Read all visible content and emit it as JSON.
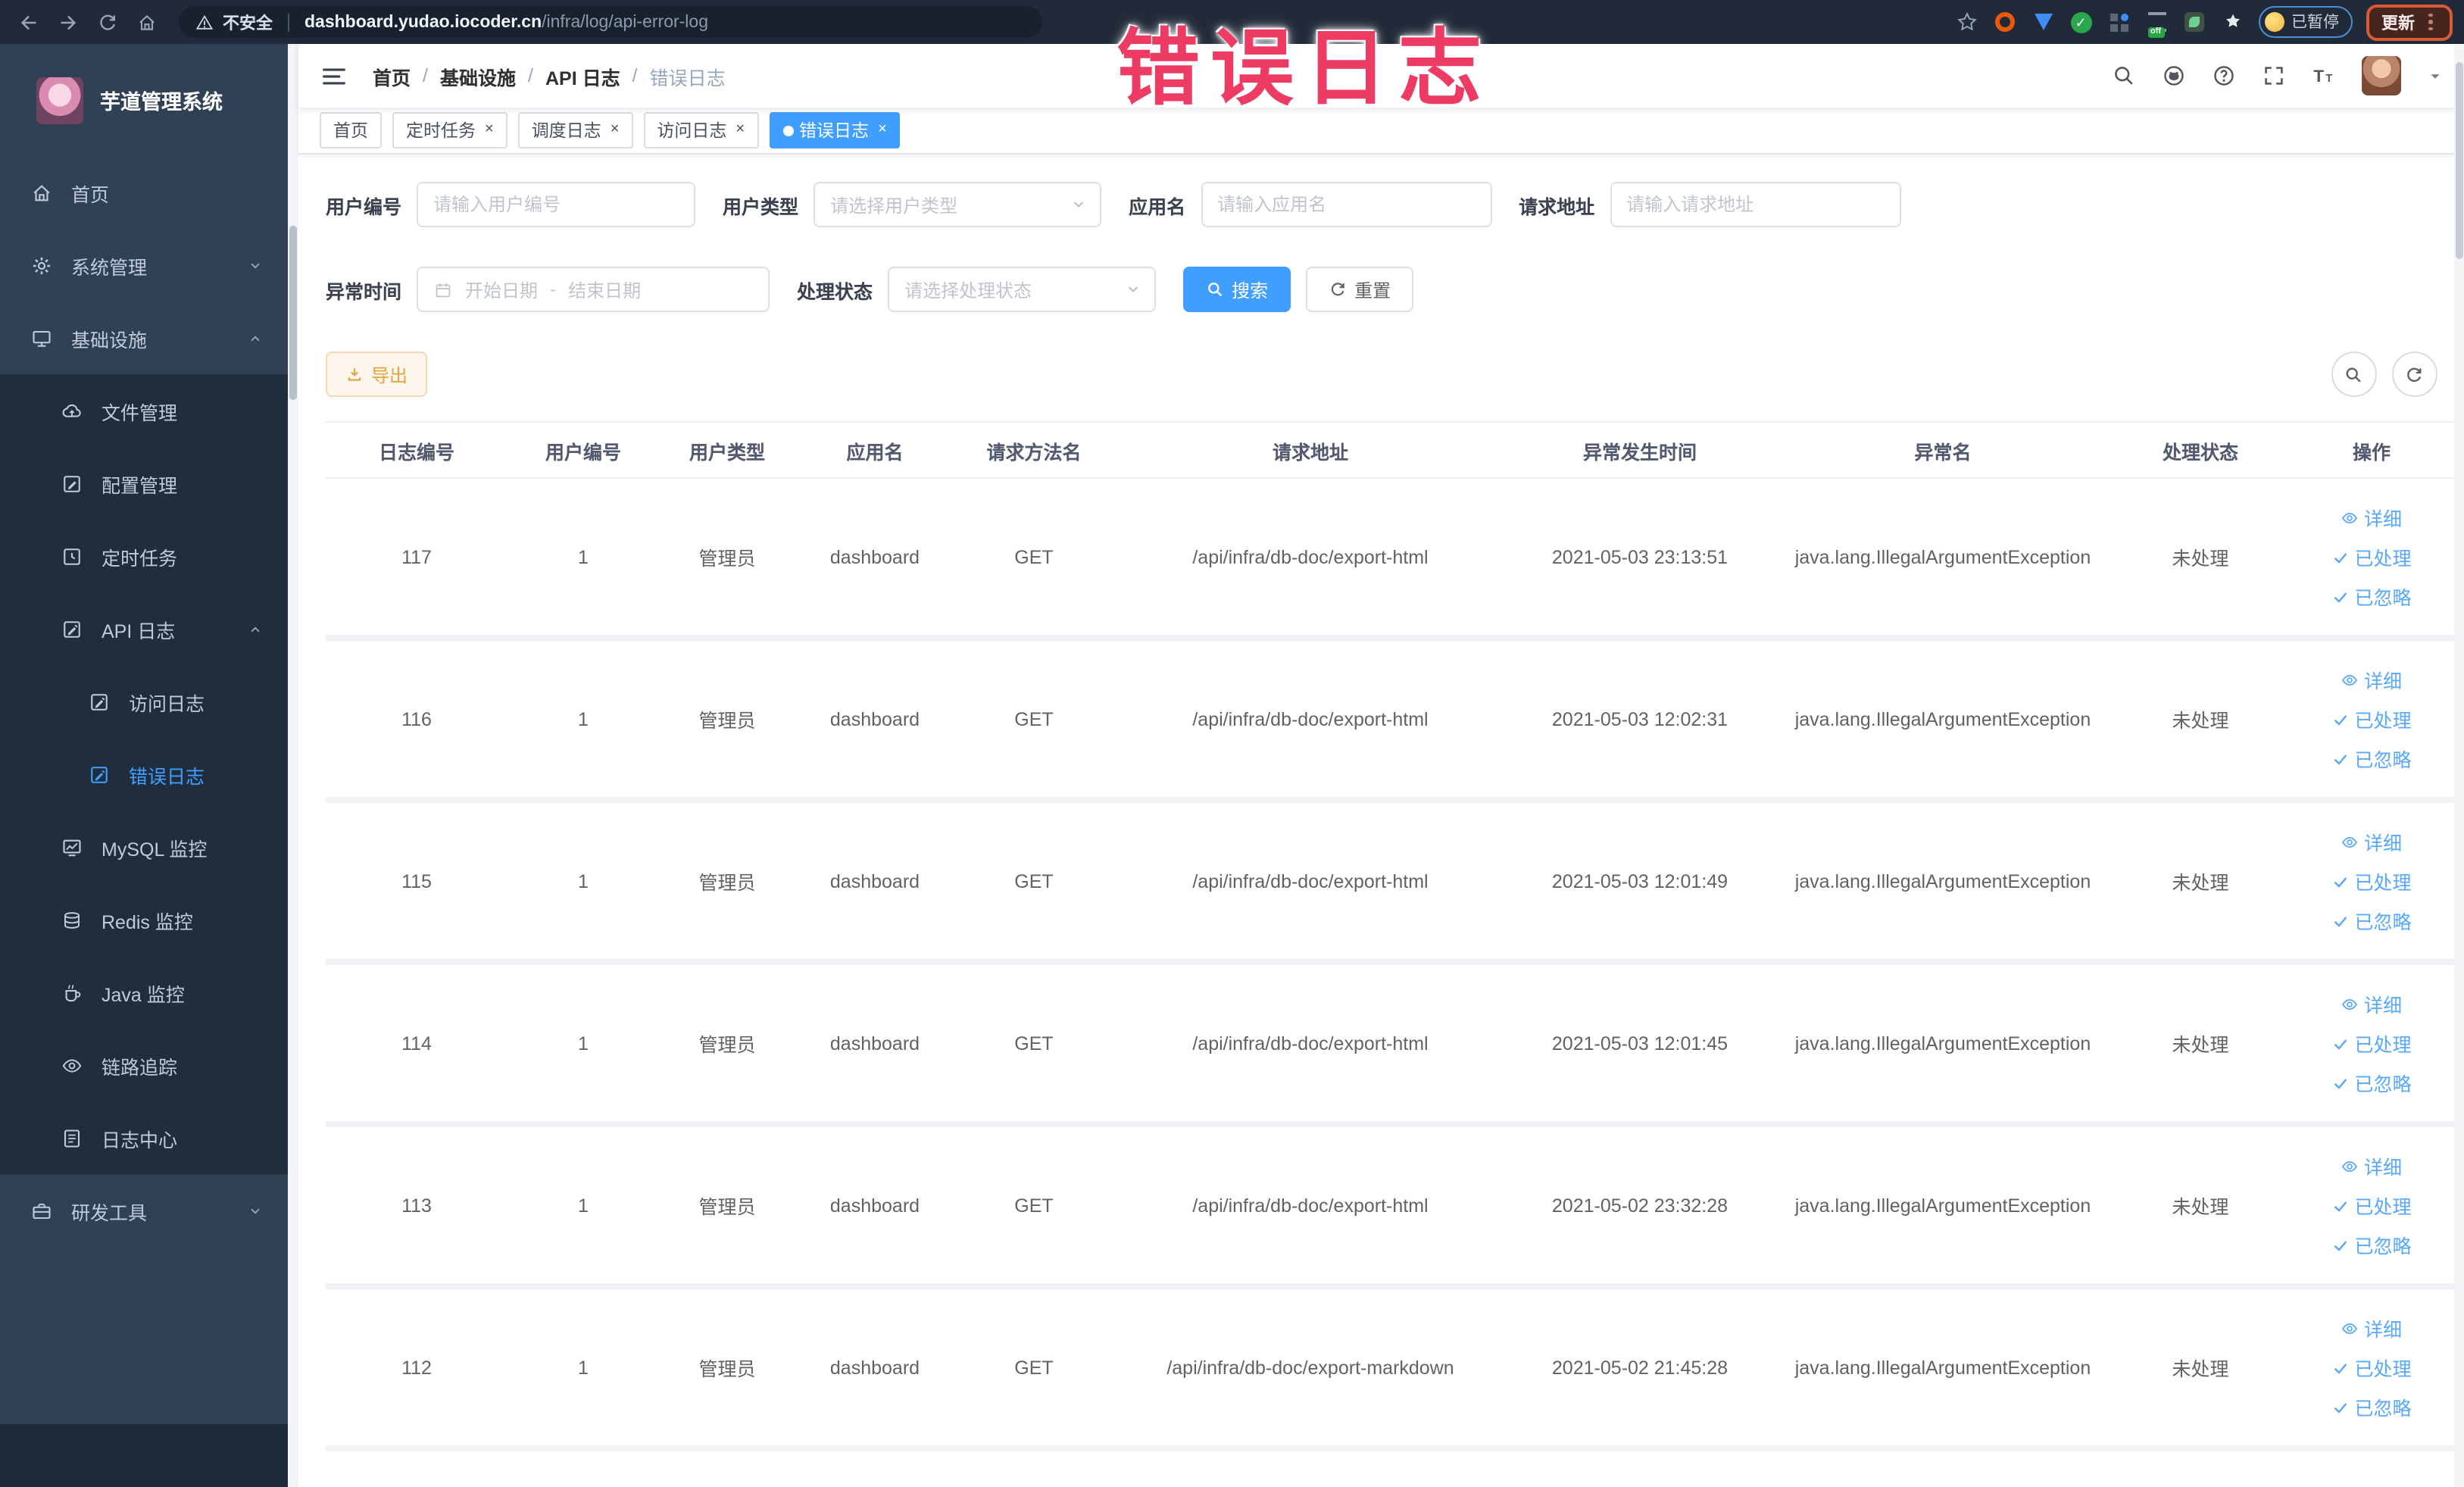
{
  "chrome": {
    "security_label": "不安全",
    "url_domain": "dashboard.yudao.iocoder.cn",
    "url_path": "/infra/log/api-error-log",
    "profile_status": "已暂停",
    "update_label": "更新"
  },
  "annotation_text": "错误日志",
  "sidebar": {
    "logo_title": "芋道管理系统",
    "items": [
      {
        "label": "首页",
        "icon": "home-icon",
        "depth": 0
      },
      {
        "label": "系统管理",
        "icon": "gear-icon",
        "depth": 0,
        "chevron": "down"
      },
      {
        "label": "基础设施",
        "icon": "infra-icon",
        "depth": 0,
        "chevron": "up"
      },
      {
        "label": "文件管理",
        "icon": "file-icon",
        "depth": 1
      },
      {
        "label": "配置管理",
        "icon": "config-icon",
        "depth": 1
      },
      {
        "label": "定时任务",
        "icon": "timer-icon",
        "depth": 1
      },
      {
        "label": "API 日志",
        "icon": "api-log-icon",
        "depth": 1,
        "chevron": "up"
      },
      {
        "label": "访问日志",
        "icon": "access-log-icon",
        "depth": 2
      },
      {
        "label": "错误日志",
        "icon": "error-log-icon",
        "depth": 2,
        "active": true
      },
      {
        "label": "MySQL 监控",
        "icon": "mysql-icon",
        "depth": 1
      },
      {
        "label": "Redis 监控",
        "icon": "redis-icon",
        "depth": 1
      },
      {
        "label": "Java 监控",
        "icon": "java-icon",
        "depth": 1
      },
      {
        "label": "链路追踪",
        "icon": "trace-icon",
        "depth": 1
      },
      {
        "label": "日志中心",
        "icon": "log-center-icon",
        "depth": 1
      },
      {
        "label": "研发工具",
        "icon": "devtools-icon",
        "depth": 0,
        "chevron": "down"
      }
    ]
  },
  "topbar": {
    "breadcrumb": [
      "首页",
      "基础设施",
      "API 日志",
      "错误日志"
    ],
    "separator": "/"
  },
  "tabs": [
    {
      "label": "首页",
      "closable": false,
      "active": false
    },
    {
      "label": "定时任务",
      "closable": true,
      "active": false
    },
    {
      "label": "调度日志",
      "closable": true,
      "active": false
    },
    {
      "label": "访问日志",
      "closable": true,
      "active": false
    },
    {
      "label": "错误日志",
      "closable": true,
      "active": true
    }
  ],
  "filters": {
    "user_id": {
      "label": "用户编号",
      "placeholder": "请输入用户编号"
    },
    "user_type": {
      "label": "用户类型",
      "placeholder": "请选择用户类型"
    },
    "app_name": {
      "label": "应用名",
      "placeholder": "请输入应用名"
    },
    "request_url": {
      "label": "请求地址",
      "placeholder": "请输入请求地址"
    },
    "exception_time": {
      "label": "异常时间",
      "start_placeholder": "开始日期",
      "separator": "-",
      "end_placeholder": "结束日期"
    },
    "process_status": {
      "label": "处理状态",
      "placeholder": "请选择处理状态"
    },
    "search_label": "搜索",
    "reset_label": "重置"
  },
  "toolbar": {
    "export_label": "导出"
  },
  "table": {
    "columns": [
      "日志编号",
      "用户编号",
      "用户类型",
      "应用名",
      "请求方法名",
      "请求地址",
      "异常发生时间",
      "异常名",
      "处理状态",
      "操作"
    ],
    "actions": [
      {
        "label": "详细",
        "icon": "eye-icon"
      },
      {
        "label": "已处理",
        "icon": "check-icon"
      },
      {
        "label": "已忽略",
        "icon": "check-icon"
      }
    ],
    "rows": [
      {
        "log_id": "117",
        "user_id": "1",
        "user_type": "管理员",
        "app_name": "dashboard",
        "method": "GET",
        "url": "/api/infra/db-doc/export-html",
        "time": "2021-05-03 23:13:51",
        "exception": "java.lang.IllegalArgumentException",
        "status": "未处理"
      },
      {
        "log_id": "116",
        "user_id": "1",
        "user_type": "管理员",
        "app_name": "dashboard",
        "method": "GET",
        "url": "/api/infra/db-doc/export-html",
        "time": "2021-05-03 12:02:31",
        "exception": "java.lang.IllegalArgumentException",
        "status": "未处理"
      },
      {
        "log_id": "115",
        "user_id": "1",
        "user_type": "管理员",
        "app_name": "dashboard",
        "method": "GET",
        "url": "/api/infra/db-doc/export-html",
        "time": "2021-05-03 12:01:49",
        "exception": "java.lang.IllegalArgumentException",
        "status": "未处理"
      },
      {
        "log_id": "114",
        "user_id": "1",
        "user_type": "管理员",
        "app_name": "dashboard",
        "method": "GET",
        "url": "/api/infra/db-doc/export-html",
        "time": "2021-05-03 12:01:45",
        "exception": "java.lang.IllegalArgumentException",
        "status": "未处理"
      },
      {
        "log_id": "113",
        "user_id": "1",
        "user_type": "管理员",
        "app_name": "dashboard",
        "method": "GET",
        "url": "/api/infra/db-doc/export-html",
        "time": "2021-05-02 23:32:28",
        "exception": "java.lang.IllegalArgumentException",
        "status": "未处理"
      },
      {
        "log_id": "112",
        "user_id": "1",
        "user_type": "管理员",
        "app_name": "dashboard",
        "method": "GET",
        "url": "/api/infra/db-doc/export-markdown",
        "time": "2021-05-02 21:45:28",
        "exception": "java.lang.IllegalArgumentException",
        "status": "未处理"
      }
    ]
  },
  "colors": {
    "accent_blue": "#409eff",
    "sidebar_bg": "#304156",
    "sidebar_submenu_bg": "#1f2d3d",
    "sidebar_text": "#bfcbd9",
    "export_warning": "#e6a23c",
    "annotation_pink": "#ee3b63",
    "chrome_bar": "#202a38"
  }
}
